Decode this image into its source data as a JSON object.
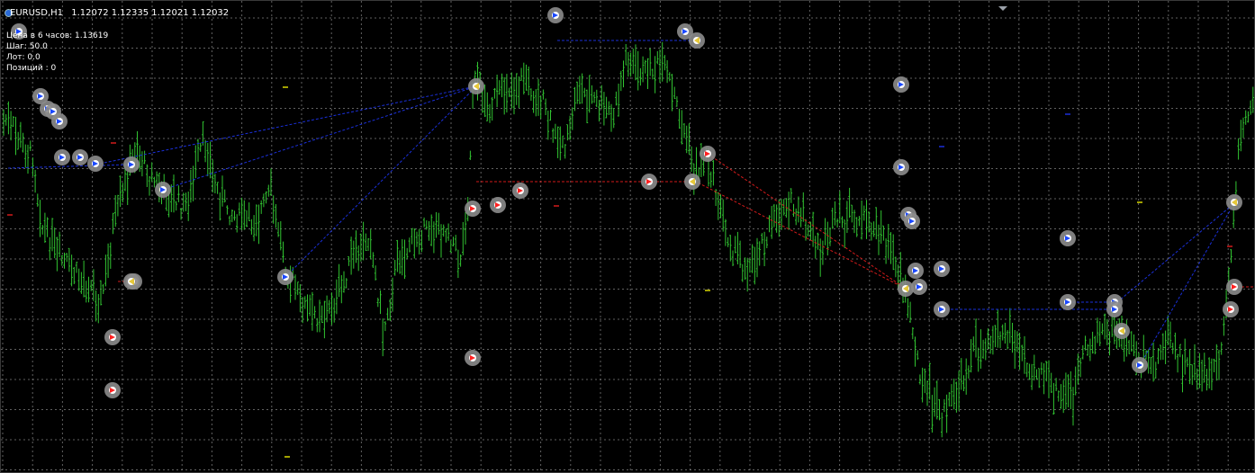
{
  "header": {
    "symbol": "EURUSD,H1",
    "ohlc": "1.12072 1.12335 1.12021 1.12032"
  },
  "info_panel": {
    "line1": "Цена в 6 часов: 1.13619",
    "line2": "Шаг: 50.0",
    "line3": "Лот: 0.0",
    "line4": "Позиций : 0"
  },
  "colors": {
    "background": "#000000",
    "grid": "#8a8a8a",
    "candles": "#31c431",
    "buy_line": "#1a2fd8",
    "sell_line": "#d21a1a",
    "marker_ring": "#8c8c8c",
    "buy_arrow": "#1a48ff",
    "sell_arrow": "#ff2020",
    "close_marker": "#e6c83a",
    "tag_yellow": "#d8d800"
  },
  "icons": {
    "buy_marker": "buy-arrow-icon",
    "sell_marker": "sell-arrow-icon",
    "close_marker": "close-position-icon"
  }
}
